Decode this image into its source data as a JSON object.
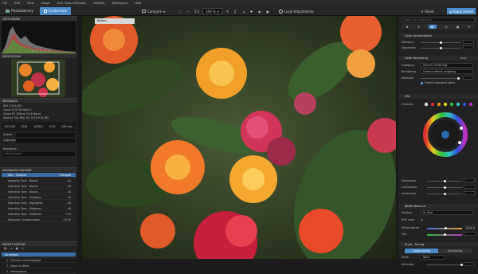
{
  "menu": [
    "File",
    "Edit",
    "View",
    "Image",
    "DxO Optics Modules",
    "Palettes",
    "Workspace",
    "Help"
  ],
  "tabs": {
    "library": "PhotoLibrary",
    "customize": "Customize"
  },
  "toolbar": {
    "compare": "Compare",
    "zoom": "1:1",
    "zoom_pct": "100 %",
    "local_adjust": "Local Adjustments",
    "reset": "Reset",
    "apply": "Apply preset"
  },
  "left": {
    "histogram": "HISTOGRAM",
    "movezoom": "MOVE/ZOOM",
    "metadata": "METADATA",
    "meta_lines": [
      "IMG_1234.CR2",
      "Canon EOS 5D Mark II",
      "Canon EF 100mm f/2.8 Macro",
      "Shot on Tue, May 26, 2015 9:24 AM"
    ],
    "exif": [
      "ISO 400",
      "f/5.6",
      "1/250 s",
      "0 EV",
      "100 mm"
    ],
    "author": "Author",
    "copyright": "Copyright",
    "keywords": "Keywords",
    "add_keyword": "Add Keyword",
    "history": "ADVANCED HISTORY",
    "history_rows": [
      [
        "HSL - Channel",
        "Changed"
      ],
      [
        "Selective Tone - Blacks",
        "-14"
      ],
      [
        "Selective Tone - Blacks",
        "-26"
      ],
      [
        "Selective Tone - Blacks",
        "-44"
      ],
      [
        "Selective Tone - Shadows",
        "+8"
      ],
      [
        "Selective Tone - Highlights",
        "-20"
      ],
      [
        "Selective Tone - Midtones",
        "+6"
      ],
      [
        "Selective Tone - Midtones",
        "+10"
      ],
      [
        "Exposure Compensation",
        "+0.30"
      ]
    ],
    "preset_editor": "PRESET EDITOR",
    "presets": [
      "All presets",
      "1 - Portrait and Landscape",
      "2 - Black & White",
      "3 - Atmospheric"
    ]
  },
  "viewer": {
    "button": "Before"
  },
  "right": {
    "search_placeholder": "Search for corrections...",
    "color_acc": "Color Accentuation",
    "vibrancy": "Vibrancy",
    "saturation": "Saturation",
    "color_rend": "Color Rendering",
    "auto": "Auto",
    "category": "Category",
    "category_val": "Generic renderings",
    "rendering": "Rendering",
    "rendering_val": "Camera default rendering",
    "intensity": "Intensity",
    "protect": "Protect saturated colors",
    "hsl": "HSL",
    "channel": "Channel",
    "sat2": "Saturation",
    "lum": "Luminance",
    "uni": "Uniformity",
    "wb": "White Balance",
    "setting": "Setting",
    "setting_val": "As Shot",
    "pick": "Pick color",
    "temp": "Temperature",
    "temp_val": "3404 K",
    "tint": "Tint",
    "style": "Style - Toning",
    "simple": "Simple toning",
    "split": "Split toning",
    "style_lbl": "Style",
    "style_val": "None"
  }
}
